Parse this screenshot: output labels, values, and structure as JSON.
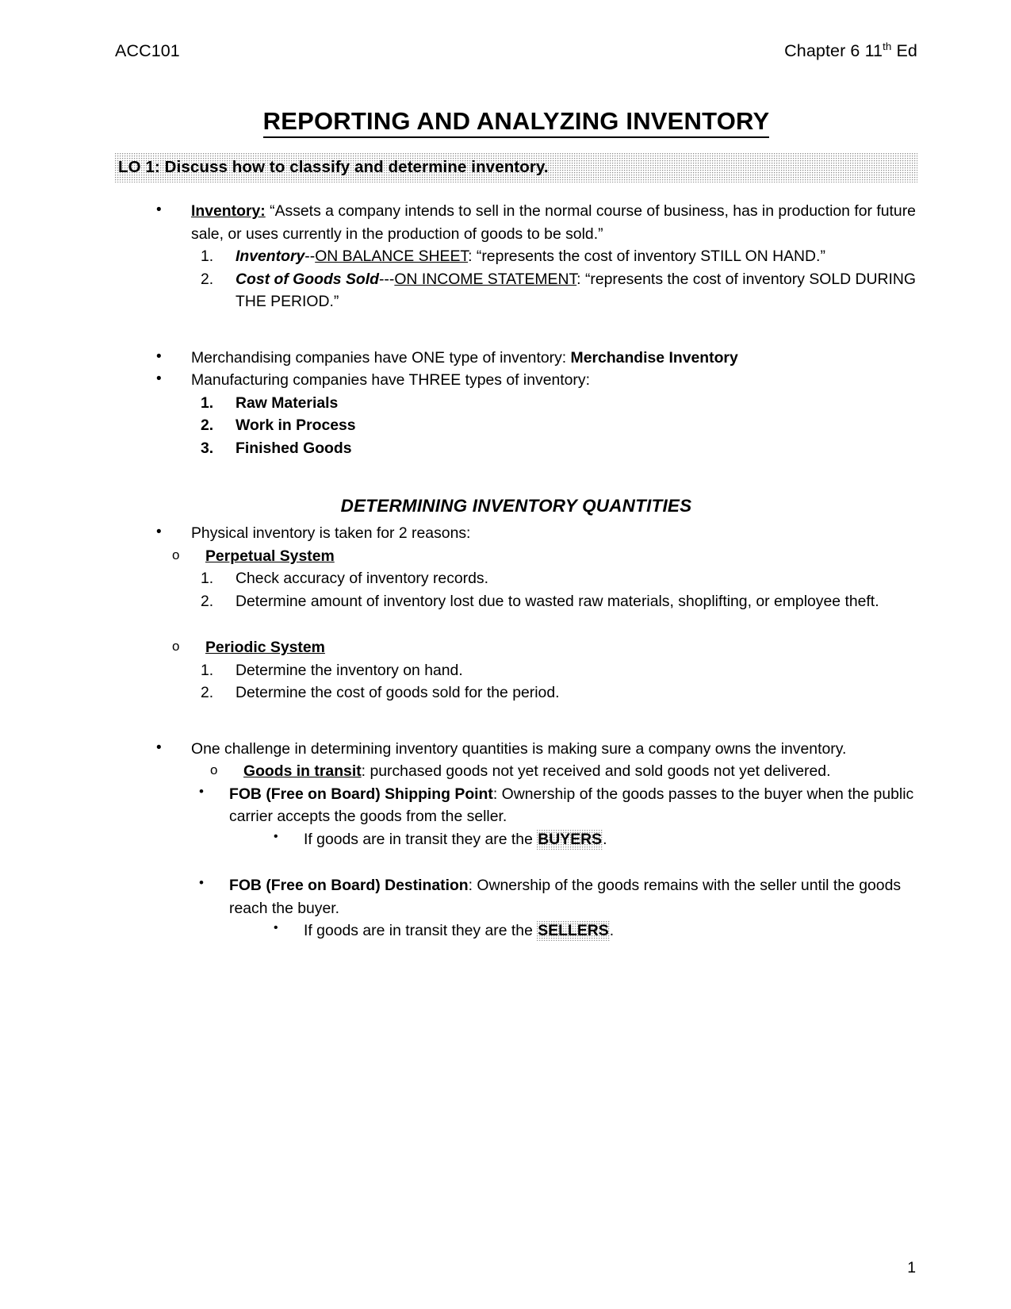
{
  "header": {
    "course_code": "ACC101",
    "chapter_prefix": "Chapter 6 11",
    "chapter_sup": "th",
    "chapter_suffix": " Ed"
  },
  "title": "REPORTING AND ANALYZING INVENTORY",
  "lo_banner": "LO 1:  Discuss how to classify and determine inventory.",
  "inventory": {
    "term": "Inventory:",
    "definition": " “Assets a company intends to sell in the normal course of business, has in production for future sale, or uses currently in the production of goods to be sold.”",
    "items": [
      {
        "marker": "1.",
        "term": "Inventory",
        "dashes": "--",
        "underlined": "ON BALANCE SHEET",
        "rest": ": “represents the cost of inventory STILL ON HAND.”"
      },
      {
        "marker": "2.",
        "term": "Cost of Goods Sold",
        "dashes": "---",
        "underlined": "ON INCOME STATEMENT",
        "rest": ": “represents the cost of inventory SOLD DURING THE PERIOD.”"
      }
    ]
  },
  "company_types": {
    "merchandising_lead": "Merchandising companies have ONE type of inventory:  ",
    "merchandising_bold": "Merchandise Inventory",
    "manufacturing_lead": "Manufacturing companies have THREE types of inventory:",
    "manufacturing_items": [
      {
        "marker": "1.",
        "label": "Raw Materials"
      },
      {
        "marker": "2.",
        "label": "Work in Process"
      },
      {
        "marker": "3.",
        "label": "Finished Goods"
      }
    ]
  },
  "determining": {
    "heading": "DETERMINING INVENTORY QUANTITIES",
    "physical_lead": "Physical inventory is taken for 2 reasons:",
    "systems": [
      {
        "name": "Perpetual System",
        "reasons": [
          {
            "marker": "1.",
            "text": "Check accuracy of inventory records."
          },
          {
            "marker": "2.",
            "text": "Determine amount of inventory lost due to wasted raw materials, shoplifting, or employee theft."
          }
        ]
      },
      {
        "name": "Periodic System",
        "reasons": [
          {
            "marker": "1.",
            "text": "Determine the inventory on hand."
          },
          {
            "marker": "2.",
            "text": "Determine the cost of goods sold for the period."
          }
        ]
      }
    ]
  },
  "ownership": {
    "challenge": "One challenge in determining inventory quantities is making sure a company owns the inventory.",
    "goods_in_transit_term": "Goods in transit",
    "goods_in_transit_rest": ":  purchased goods not yet received and sold goods not yet delivered.",
    "fob": [
      {
        "term": "FOB (Free on Board) Shipping Point",
        "rest": ":  Ownership of the goods passes to the buyer when the public carrier accepts the goods from the seller.",
        "sub_lead": "If goods are in transit they are the ",
        "sub_highlight": "BUYERS",
        "sub_tail": "."
      },
      {
        "term": "FOB (Free on Board) Destination",
        "rest": ":  Ownership of the goods remains with the seller until the goods reach the buyer.",
        "sub_lead": "If goods are in transit they are the ",
        "sub_highlight": "SELLERS",
        "sub_tail": "."
      }
    ]
  },
  "page_number": "1"
}
